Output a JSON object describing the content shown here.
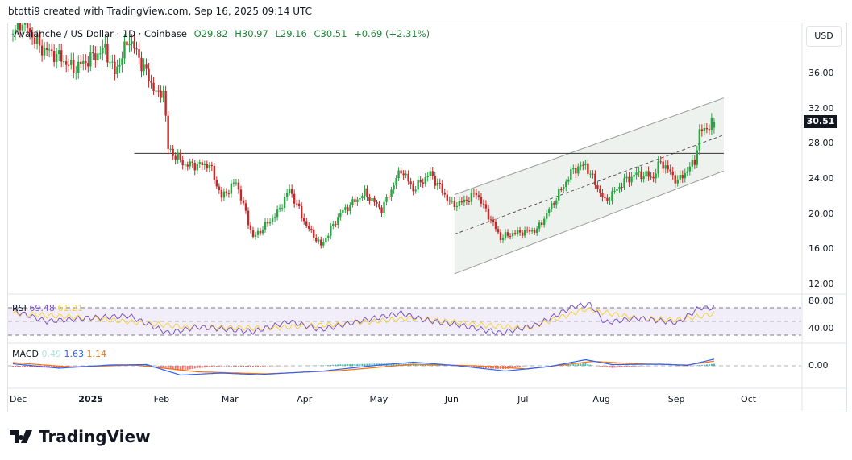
{
  "caption": "btotti9 created with TradingView.com, Sep 16, 2025 09:14 UTC",
  "legend": {
    "symbol": "Avalanche / US Dollar · 1D · Coinbase",
    "open": "O29.82",
    "high": "H30.97",
    "low": "L29.16",
    "close": "C30.51",
    "change": "+0.69 (+2.31%)"
  },
  "currency_button": "USD",
  "price_tag": "30.51",
  "rsi": {
    "label": "RSI",
    "value": "69.48",
    "ma": "61.21",
    "axis": [
      "80.00",
      "40.00"
    ]
  },
  "macd": {
    "label": "MACD",
    "hist": "0.49",
    "macd": "1.63",
    "signal": "1.14",
    "axis": "0.00"
  },
  "branding": "TradingView",
  "colors": {
    "up": "#089981",
    "down": "#f23645",
    "candle_up": "#26a641",
    "candle_down": "#c62828",
    "rsi": "#7e57c2",
    "rsi_ma": "#f5d33c",
    "macd": "#2962ff",
    "signal": "#ff6d00",
    "channel_fill": "#eef2ee"
  },
  "chart_data": {
    "type": "candlestick",
    "symbol": "AVAX/USD",
    "y_ticks": [
      "36.00",
      "32.00",
      "28.00",
      "24.00",
      "20.00",
      "16.00",
      "12.00"
    ],
    "ylim": [
      12,
      41
    ],
    "x_ticks": [
      "Dec",
      "2025",
      "Feb",
      "Mar",
      "Apr",
      "May",
      "Jun",
      "Jul",
      "Aug",
      "Sep",
      "Oct"
    ],
    "close_waypoints": [
      [
        "2024-12-01",
        40.5
      ],
      [
        "2024-12-05",
        42
      ],
      [
        "2024-12-12",
        39
      ],
      [
        "2024-12-20",
        37.9
      ],
      [
        "2024-12-26",
        36.5
      ],
      [
        "2025-01-01",
        37.5
      ],
      [
        "2025-01-08",
        38.8
      ],
      [
        "2025-01-12",
        36
      ],
      [
        "2025-01-18",
        40
      ],
      [
        "2025-01-25",
        36
      ],
      [
        "2025-01-30",
        33.3
      ],
      [
        "2025-02-01",
        34.3
      ],
      [
        "2025-02-03",
        27.4
      ],
      [
        "2025-02-10",
        25.6
      ],
      [
        "2025-02-20",
        25.6
      ],
      [
        "2025-02-25",
        21.9
      ],
      [
        "2025-03-03",
        23.7
      ],
      [
        "2025-03-10",
        17.3
      ],
      [
        "2025-03-20",
        20.1
      ],
      [
        "2025-03-25",
        22.8
      ],
      [
        "2025-04-01",
        18.7
      ],
      [
        "2025-04-07",
        16.4
      ],
      [
        "2025-04-15",
        20.1
      ],
      [
        "2025-04-25",
        22.4
      ],
      [
        "2025-05-02",
        20.5
      ],
      [
        "2025-05-10",
        25.1
      ],
      [
        "2025-05-15",
        22.8
      ],
      [
        "2025-05-22",
        24.6
      ],
      [
        "2025-05-31",
        21
      ],
      [
        "2025-06-05",
        21.4
      ],
      [
        "2025-06-10",
        22.4
      ],
      [
        "2025-06-20",
        17.3
      ],
      [
        "2025-06-25",
        17.8
      ],
      [
        "2025-07-05",
        18.2
      ],
      [
        "2025-07-12",
        21.4
      ],
      [
        "2025-07-20",
        25.1
      ],
      [
        "2025-07-25",
        25.6
      ],
      [
        "2025-08-02",
        21.4
      ],
      [
        "2025-08-10",
        23.7
      ],
      [
        "2025-08-15",
        24.6
      ],
      [
        "2025-08-22",
        24.2
      ],
      [
        "2025-08-25",
        26
      ],
      [
        "2025-09-01",
        23.7
      ],
      [
        "2025-09-08",
        26
      ],
      [
        "2025-09-10",
        29.2
      ],
      [
        "2025-09-16",
        30.51
      ]
    ],
    "last_ohlc": {
      "open": 29.82,
      "high": 30.97,
      "low": 29.16,
      "close": 30.51
    },
    "drawings": {
      "horizontal_line": {
        "price": 26.9,
        "from": "2025-01-20",
        "to": "2025-09-20"
      },
      "channel": {
        "from": "2025-06-01",
        "to": "2025-09-20",
        "upper": [
          22.2,
          33.2
        ],
        "middle": [
          17.7,
          29.0
        ],
        "lower": [
          13.2,
          24.9
        ]
      }
    },
    "rsi_series": [
      [
        "2024-12-01",
        66
      ],
      [
        "2024-12-15",
        50
      ],
      [
        "2025-01-01",
        55
      ],
      [
        "2025-01-18",
        58
      ],
      [
        "2025-02-03",
        33
      ],
      [
        "2025-02-15",
        42
      ],
      [
        "2025-03-01",
        38
      ],
      [
        "2025-03-10",
        35
      ],
      [
        "2025-03-25",
        50
      ],
      [
        "2025-04-07",
        38
      ],
      [
        "2025-04-25",
        52
      ],
      [
        "2025-05-10",
        62
      ],
      [
        "2025-05-20",
        52
      ],
      [
        "2025-06-01",
        46
      ],
      [
        "2025-06-20",
        33
      ],
      [
        "2025-07-05",
        45
      ],
      [
        "2025-07-20",
        72
      ],
      [
        "2025-07-27",
        75
      ],
      [
        "2025-08-02",
        48
      ],
      [
        "2025-08-15",
        55
      ],
      [
        "2025-09-01",
        48
      ],
      [
        "2025-09-10",
        70
      ],
      [
        "2025-09-16",
        69.48
      ]
    ],
    "rsi_ma_series": [
      [
        "2024-12-01",
        62
      ],
      [
        "2025-01-01",
        55
      ],
      [
        "2025-02-10",
        42
      ],
      [
        "2025-03-15",
        40
      ],
      [
        "2025-04-15",
        46
      ],
      [
        "2025-05-15",
        55
      ],
      [
        "2025-06-15",
        44
      ],
      [
        "2025-07-01",
        40
      ],
      [
        "2025-07-25",
        68
      ],
      [
        "2025-08-15",
        55
      ],
      [
        "2025-09-01",
        52
      ],
      [
        "2025-09-16",
        61.21
      ]
    ],
    "macd_series": [
      [
        "2024-12-01",
        0.5
      ],
      [
        "2024-12-20",
        -0.6
      ],
      [
        "2025-01-10",
        0.2
      ],
      [
        "2025-01-25",
        0.3
      ],
      [
        "2025-02-08",
        -2.3
      ],
      [
        "2025-02-25",
        -1.8
      ],
      [
        "2025-03-12",
        -2.2
      ],
      [
        "2025-04-08",
        -1.3
      ],
      [
        "2025-05-01",
        0.2
      ],
      [
        "2025-05-15",
        0.9
      ],
      [
        "2025-06-01",
        0.1
      ],
      [
        "2025-06-22",
        -1.3
      ],
      [
        "2025-07-10",
        -0.2
      ],
      [
        "2025-07-25",
        1.5
      ],
      [
        "2025-08-05",
        0.3
      ],
      [
        "2025-08-25",
        0.4
      ],
      [
        "2025-09-05",
        0.1
      ],
      [
        "2025-09-16",
        1.63
      ]
    ],
    "signal_series": [
      [
        "2024-12-01",
        0.8
      ],
      [
        "2024-12-25",
        -0.3
      ],
      [
        "2025-01-20",
        0.2
      ],
      [
        "2025-02-15",
        -1.5
      ],
      [
        "2025-03-15",
        -2.0
      ],
      [
        "2025-04-15",
        -1.2
      ],
      [
        "2025-05-15",
        0.4
      ],
      [
        "2025-06-10",
        0.0
      ],
      [
        "2025-07-01",
        -0.8
      ],
      [
        "2025-07-28",
        1.1
      ],
      [
        "2025-08-15",
        0.5
      ],
      [
        "2025-09-05",
        0.2
      ],
      [
        "2025-09-16",
        1.14
      ]
    ]
  }
}
